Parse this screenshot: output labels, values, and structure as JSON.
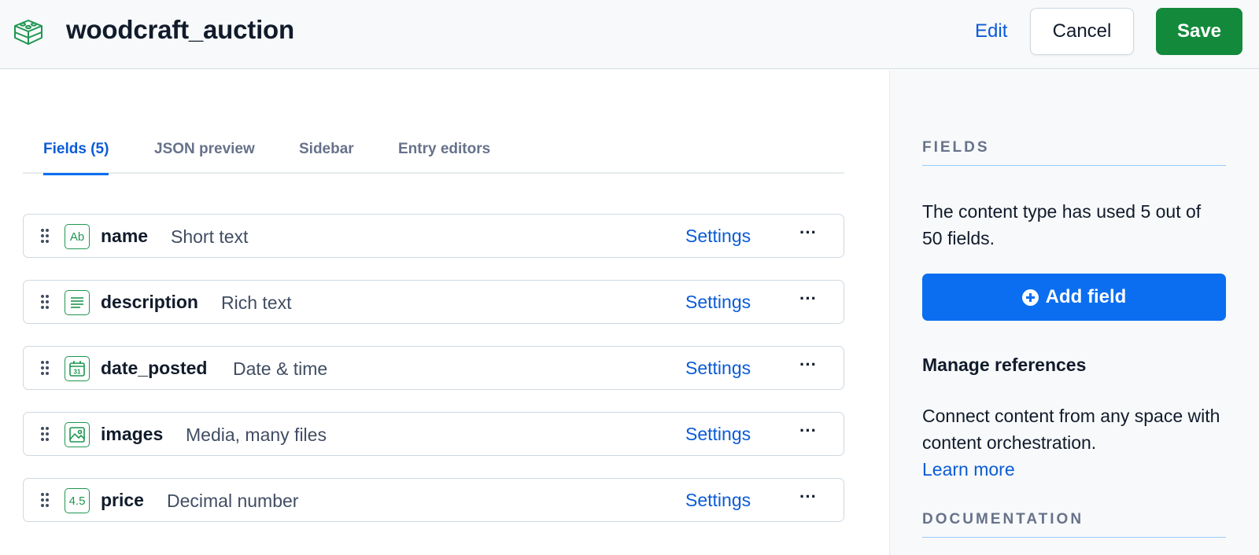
{
  "header": {
    "title": "woodcraft_auction",
    "edit_label": "Edit",
    "cancel_label": "Cancel",
    "save_label": "Save"
  },
  "tabs": [
    {
      "label": "Fields (5)",
      "active": true
    },
    {
      "label": "JSON preview",
      "active": false
    },
    {
      "label": "Sidebar",
      "active": false
    },
    {
      "label": "Entry editors",
      "active": false
    }
  ],
  "fields": [
    {
      "name": "name",
      "type": "Short text",
      "icon": "short-text-icon",
      "icon_text": "Ab",
      "settings_label": "Settings"
    },
    {
      "name": "description",
      "type": "Rich text",
      "icon": "rich-text-icon",
      "icon_text": "",
      "settings_label": "Settings"
    },
    {
      "name": "date_posted",
      "type": "Date & time",
      "icon": "calendar-icon",
      "icon_text": "31",
      "settings_label": "Settings"
    },
    {
      "name": "images",
      "type": "Media, many files",
      "icon": "image-icon",
      "icon_text": "",
      "settings_label": "Settings"
    },
    {
      "name": "price",
      "type": "Decimal number",
      "icon": "decimal-number-icon",
      "icon_text": "4.5",
      "settings_label": "Settings"
    }
  ],
  "sidebar": {
    "fields_heading": "FIELDS",
    "usage_text": "The content type has used 5 out of 50 fields.",
    "add_field_label": "Add field",
    "manage_heading": "Manage references",
    "connect_text": "Connect content from any space with content orchestration.",
    "learn_more_label": "Learn more",
    "documentation_heading": "DOCUMENTATION"
  },
  "colors": {
    "accent_blue": "#0b6ef0",
    "link_blue": "#0b5bd6",
    "save_green": "#138a3b",
    "icon_green": "#1f9650"
  }
}
